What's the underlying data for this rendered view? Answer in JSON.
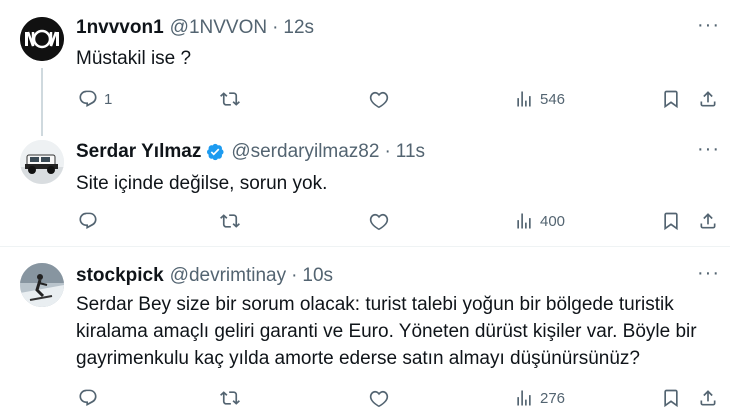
{
  "tweets": [
    {
      "name": "1nvvvon1",
      "handle": "@1NVVON",
      "time": "12s",
      "text": "Müstakil ise ?",
      "reply_count": "1",
      "view_count": "546",
      "verified": false
    },
    {
      "name": "Serdar Yılmaz",
      "handle": "@serdaryilmaz82",
      "time": "11s",
      "text": "Site içinde değilse, sorun yok.",
      "reply_count": "",
      "view_count": "400",
      "verified": true
    },
    {
      "name": "stockpick",
      "handle": "@devrimtinay",
      "time": "10s",
      "text": "Serdar Bey size bir sorum olacak: turist talebi yoğun bir bölgede turistik kiralama amaçlı geliri garanti ve Euro. Yöneten dürüst kişiler var. Böyle bir gayrimenkulu kaç yılda amorte ederse satın almayı düşünürsünüz?",
      "reply_count": "",
      "view_count": "276",
      "verified": false
    }
  ],
  "separator": "·",
  "more_glyph": "···",
  "colors": {
    "text": "#0f1419",
    "secondary": "#536471",
    "verified": "#1d9bf0",
    "divider": "#eff3f4"
  },
  "icons": [
    "reply-icon",
    "retweet-icon",
    "like-icon",
    "views-icon",
    "bookmark-icon",
    "share-icon",
    "more-icon",
    "verified-badge-icon"
  ]
}
